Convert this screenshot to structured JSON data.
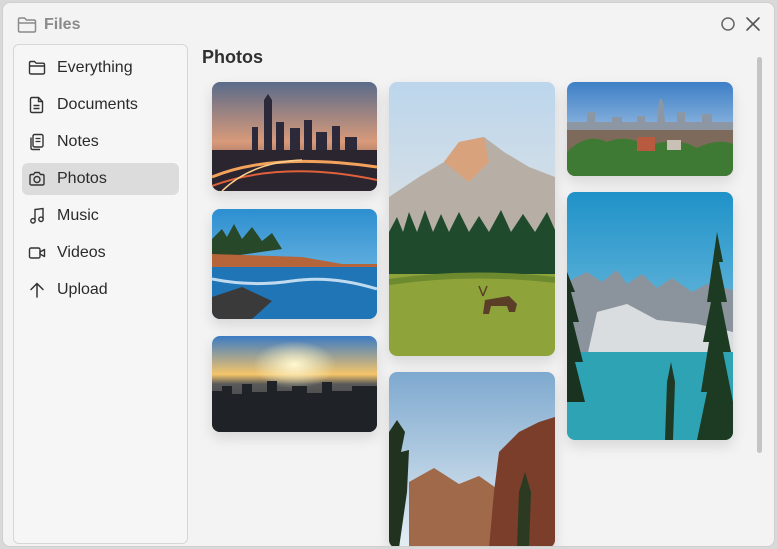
{
  "window": {
    "title": "Files"
  },
  "sidebar": {
    "items": [
      {
        "label": "Everything",
        "icon": "folder-icon"
      },
      {
        "label": "Documents",
        "icon": "document-icon"
      },
      {
        "label": "Notes",
        "icon": "notes-icon"
      },
      {
        "label": "Photos",
        "icon": "camera-icon",
        "active": true
      },
      {
        "label": "Music",
        "icon": "music-note-icon"
      },
      {
        "label": "Videos",
        "icon": "video-camera-icon"
      },
      {
        "label": "Upload",
        "icon": "arrow-up-icon"
      }
    ]
  },
  "main": {
    "title": "Photos",
    "photos": [
      "city-skyline-dusk-photo",
      "rocky-coast-photo",
      "city-sunset-aerial-photo",
      "half-dome-elk-meadow-photo",
      "canyon-pines-photo",
      "city-skyline-day-photo",
      "mountain-lake-pines-photo"
    ]
  },
  "colors": {
    "active_item": "#dcdcdc",
    "window_bg": "#f3f3f3"
  }
}
